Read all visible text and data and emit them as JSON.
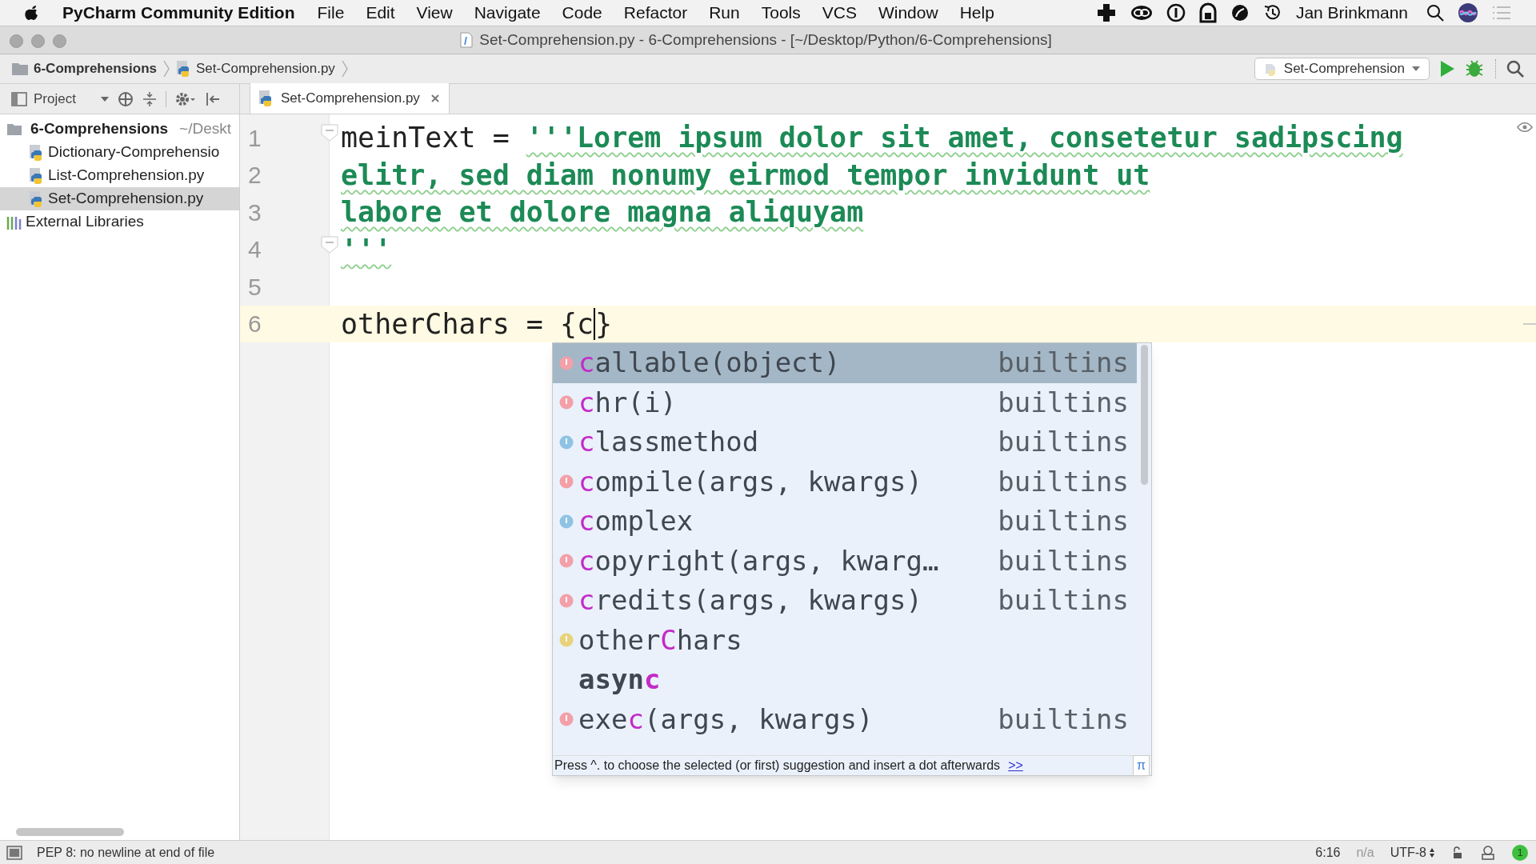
{
  "menu_bar": {
    "app_name": "PyCharm Community Edition",
    "menus": [
      "File",
      "Edit",
      "View",
      "Navigate",
      "Code",
      "Refactor",
      "Run",
      "Tools",
      "VCS",
      "Window",
      "Help"
    ],
    "user": "Jan Brinkmann"
  },
  "window": {
    "title": "Set-Comprehension.py - 6-Comprehensions - [~/Desktop/Python/6-Comprehensions]"
  },
  "breadcrumbs": [
    {
      "label": "Set-Comprehension.py",
      "kind": "file"
    }
  ],
  "breadcrumb_root": {
    "label": "6-Comprehensions"
  },
  "run_config": {
    "label": "Set-Comprehension"
  },
  "project_panel": {
    "title": "Project"
  },
  "tabs": [
    {
      "label": "Set-Comprehension.py",
      "selected": true
    }
  ],
  "tree": [
    {
      "label": "6-Comprehensions",
      "hint": "~/Deskt",
      "kind": "folder",
      "selected": false,
      "children": [
        {
          "label": "Dictionary-Comprehensio",
          "kind": "file",
          "selected": false
        },
        {
          "label": "List-Comprehension.py",
          "kind": "file",
          "selected": false
        },
        {
          "label": "Set-Comprehension.py",
          "kind": "file",
          "selected": true
        }
      ]
    },
    {
      "label": "External Libraries",
      "kind": "library",
      "selected": false
    }
  ],
  "code": [
    {
      "number": "1",
      "current": false,
      "fold": true,
      "tokens": [
        {
          "kind": "ident",
          "text": "meinText"
        },
        {
          "kind": "op",
          "text": " = "
        },
        {
          "kind": "string",
          "text": "'''Lorem ipsum dolor sit amet, consetetur sadipscing"
        }
      ]
    },
    {
      "number": "2",
      "current": false,
      "fold": false,
      "tokens": [
        {
          "kind": "string",
          "text": "elitr, sed diam nonumy eirmod tempor invidunt ut"
        }
      ]
    },
    {
      "number": "3",
      "current": false,
      "fold": false,
      "tokens": [
        {
          "kind": "string",
          "text": "labore et dolore magna aliquyam"
        }
      ]
    },
    {
      "number": "4",
      "current": false,
      "fold": true,
      "tokens": [
        {
          "kind": "string",
          "text": "'''"
        }
      ]
    },
    {
      "number": "5",
      "current": false,
      "fold": false
    },
    {
      "number": "6",
      "current": true,
      "fold": false,
      "tokens": [
        {
          "kind": "ident",
          "text": "otherChars"
        },
        {
          "kind": "op",
          "text": " = "
        },
        {
          "kind": "brace",
          "text": "{"
        },
        {
          "kind": "ident",
          "text": "c",
          "caret": true
        },
        {
          "kind": "brace",
          "text": "}"
        }
      ]
    }
  ],
  "completion": {
    "items": [
      {
        "kind": "function",
        "match": "c",
        "after": "allable(object)",
        "type": "builtins",
        "selected": true
      },
      {
        "kind": "function",
        "match": "c",
        "after": "hr(i)",
        "type": "builtins",
        "selected": false
      },
      {
        "kind": "class",
        "match": "c",
        "after": "lassmethod",
        "type": "builtins",
        "selected": false
      },
      {
        "kind": "function",
        "match": "c",
        "after": "ompile(args, kwargs)",
        "type": "builtins",
        "selected": false
      },
      {
        "kind": "class",
        "match": "c",
        "after": "omplex",
        "type": "builtins",
        "selected": false
      },
      {
        "kind": "function",
        "match": "c",
        "after": "opyright(args, kwarg…",
        "type": "builtins",
        "selected": false
      },
      {
        "kind": "function",
        "match": "c",
        "after": "redits(args, kwargs)",
        "type": "builtins",
        "selected": false
      },
      {
        "kind": "variable",
        "before": "other",
        "match": "C",
        "after": "hars",
        "selected": false
      },
      {
        "kind": "keyword",
        "before": "asyn",
        "match": "c",
        "selected": false
      },
      {
        "kind": "function",
        "before": "exe",
        "match": "c",
        "after": "(args, kwargs)",
        "type": "builtins",
        "selected": false
      }
    ],
    "hint": "Press ^. to choose the selected (or first) suggestion and insert a dot afterwards",
    "hint_link": ">>",
    "corner": "π"
  },
  "status_bar": {
    "message": "PEP 8: no newline at end of file",
    "position": "6:16",
    "separator": "n/a",
    "encoding": "UTF-8",
    "notifications": "1"
  }
}
